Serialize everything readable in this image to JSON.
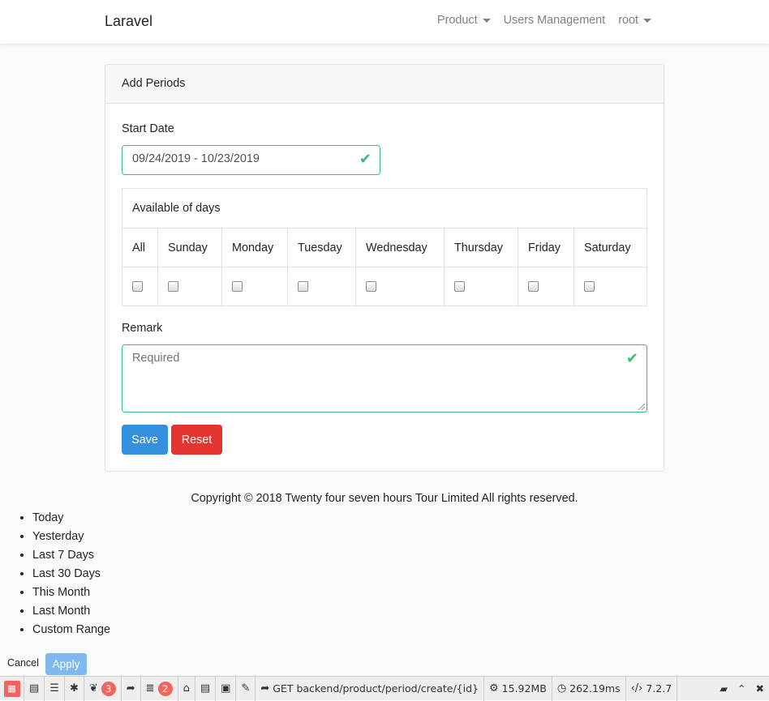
{
  "nav": {
    "brand": "Laravel",
    "product": "Product",
    "users": "Users Management",
    "user": "root"
  },
  "card": {
    "header": "Add Periods",
    "start_date_label": "Start Date",
    "start_date_value": "09/24/2019 - 10/23/2019",
    "days_caption": "Available of days",
    "days": [
      "All",
      "Sunday",
      "Monday",
      "Tuesday",
      "Wednesday",
      "Thursday",
      "Friday",
      "Saturday"
    ],
    "remark_label": "Remark",
    "remark_placeholder": "Required",
    "save": "Save",
    "reset": "Reset"
  },
  "footer": "Copyright © 2018 Twenty four seven hours Tour Limited All rights reserved.",
  "daterange": {
    "ranges": [
      "Today",
      "Yesterday",
      "Last 7 Days",
      "Last 30 Days",
      "This Month",
      "Last Month",
      "Custom Range"
    ],
    "cancel": "Cancel",
    "apply": "Apply"
  },
  "debugbar": {
    "messages_count": "3",
    "queries_count": "2",
    "request": "GET backend/product/period/create/{id}",
    "memory": "15.92MB",
    "time": "262.19ms",
    "php_version": "7.2.7"
  },
  "colors": {
    "valid": "#38c172",
    "primary": "#3490dc",
    "danger": "#e3342f"
  }
}
